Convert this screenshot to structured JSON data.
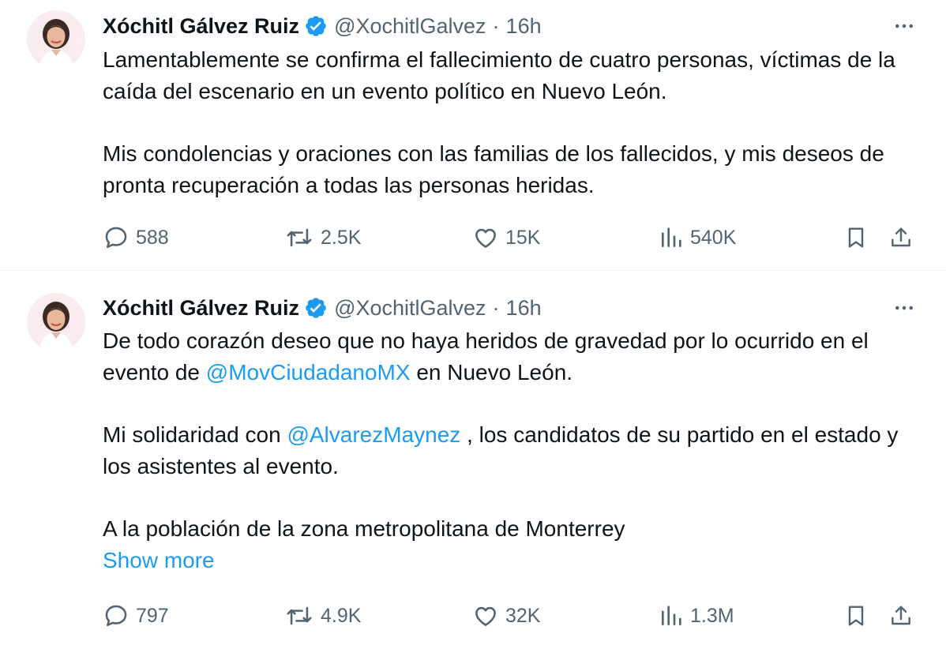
{
  "tweets": [
    {
      "author": {
        "name": "Xóchitl Gálvez Ruiz",
        "handle": "@XochitlGalvez",
        "separator": "·",
        "time": "16h",
        "verified_icon": "verified-badge-icon",
        "more_icon": "more-horizontal-icon"
      },
      "text": {
        "p1": "Lamentablemente se confirma el fallecimiento de cuatro personas, víctimas de la caída del escenario en un evento político en Nuevo León.",
        "p2": "Mis condolencias y oraciones con las familias de los fallecidos, y mis deseos de pronta recuperación a todas las personas heridas."
      },
      "stats": {
        "replies": "588",
        "reposts": "2.5K",
        "likes": "15K",
        "views": "540K"
      }
    },
    {
      "author": {
        "name": "Xóchitl Gálvez Ruiz",
        "handle": "@XochitlGalvez",
        "separator": "·",
        "time": "16h",
        "verified_icon": "verified-badge-icon",
        "more_icon": "more-horizontal-icon"
      },
      "text": {
        "p1_before": "De todo corazón deseo que no haya heridos de gravedad por lo ocurrido en el evento de ",
        "p1_mention": "@MovCiudadanoMX",
        "p1_after": " en Nuevo León.",
        "p2_before": "Mi solidaridad con ",
        "p2_mention": "@AlvarezMaynez",
        "p2_after": " , los candidatos de su partido en el estado y los asistentes al evento.",
        "p3": "A la población de la zona metropolitana de Monterrey",
        "show_more": "Show more"
      },
      "stats": {
        "replies": "797",
        "reposts": "4.9K",
        "likes": "32K",
        "views": "1.3M"
      }
    }
  ],
  "colors": {
    "text": "#0f1419",
    "secondary": "#536471",
    "link": "#1d9bf0",
    "divider": "#eff3f4",
    "verified": "#1d9bf0"
  }
}
